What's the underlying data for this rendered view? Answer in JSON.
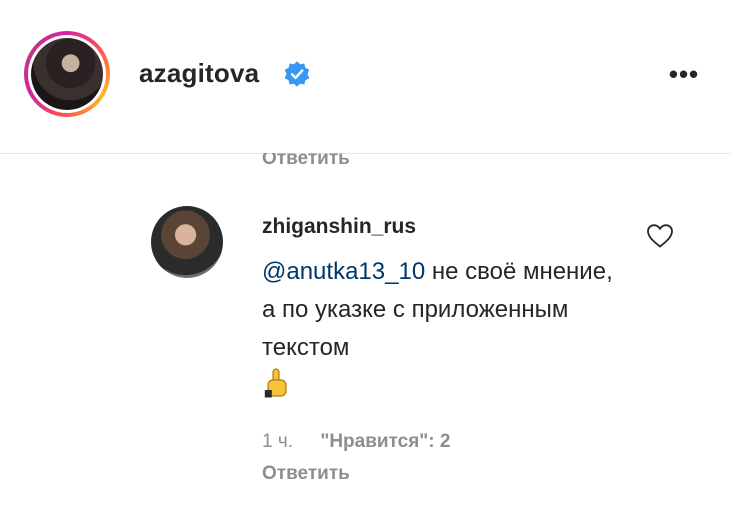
{
  "post_header": {
    "username": "azagitova",
    "verified_icon": "verified-badge-icon",
    "more_label": "•••"
  },
  "previous_comment": {
    "reply_label": "Ответить"
  },
  "comment": {
    "username": "zhiganshin_rus",
    "mention": "@anutka13_10",
    "text": " не своё мнение, а по указке с приложенным текстом",
    "emoji": "☝",
    "time": "1 ч.",
    "likes": "\"Нравится\": 2",
    "reply_label": "Ответить",
    "like_icon": "heart-icon"
  },
  "colors": {
    "text": "#262626",
    "secondary": "#8e8e8e",
    "verified": "#3897f0",
    "mention": "#00376b"
  }
}
